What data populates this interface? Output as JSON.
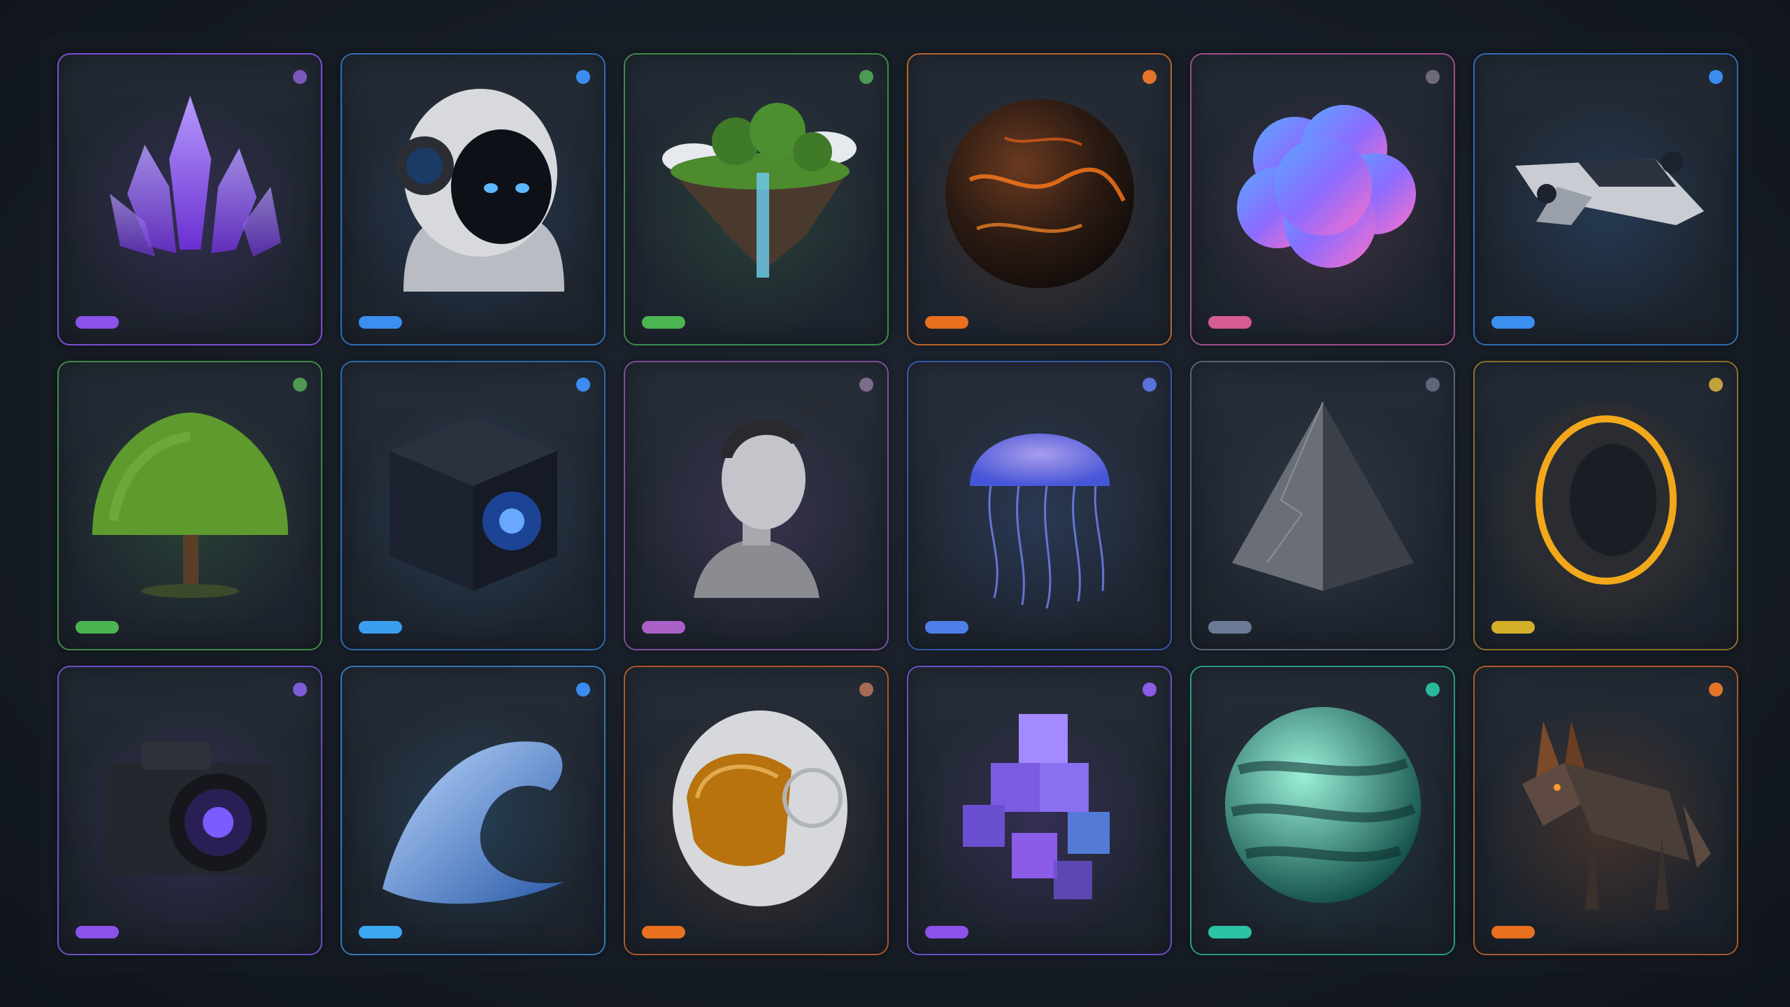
{
  "gallery": {
    "cards": [
      {
        "name": "crystal",
        "icon": "crystal-cluster-icon",
        "accent": "#7b4fd6",
        "dot": "#7a58b8",
        "pill": "#8a52e8"
      },
      {
        "name": "robot-head",
        "icon": "robot-astronaut-head-icon",
        "accent": "#2d6fb5",
        "dot": "#3a8cf0",
        "pill": "#3b8ff0"
      },
      {
        "name": "floating-island",
        "icon": "floating-island-icon",
        "accent": "#3d8a4a",
        "dot": "#4b9b53",
        "pill": "#4bb552"
      },
      {
        "name": "lava-planet",
        "icon": "lava-planet-icon",
        "accent": "#b8642a",
        "dot": "#e3742a",
        "pill": "#e8701f"
      },
      {
        "name": "pastel-cloud",
        "icon": "pastel-cloud-icon",
        "accent": "#a04e8c",
        "dot": "#6f6a7a",
        "pill": "#d45c93"
      },
      {
        "name": "spaceship",
        "icon": "spaceship-icon",
        "accent": "#2e6cb4",
        "dot": "#3a8cf0",
        "pill": "#3b8ff0"
      },
      {
        "name": "tree",
        "icon": "tree-icon",
        "accent": "#3f8a45",
        "dot": "#4e9a55",
        "pill": "#4bb552"
      },
      {
        "name": "tech-cube",
        "icon": "tech-cube-icon",
        "accent": "#2c6ab0",
        "dot": "#3a8cf0",
        "pill": "#3b9ef0"
      },
      {
        "name": "portrait-bust",
        "icon": "portrait-bust-icon",
        "accent": "#7d4f9e",
        "dot": "#7c6c8a",
        "pill": "#a961c8"
      },
      {
        "name": "jellyfish",
        "icon": "jellyfish-icon",
        "accent": "#3158a8",
        "dot": "#5a72d8",
        "pill": "#4e7fe8"
      },
      {
        "name": "stone-pyramid",
        "icon": "stone-pyramid-icon",
        "accent": "#5a6478",
        "dot": "#5e6678",
        "pill": "#6c7a96"
      },
      {
        "name": "golden-ring",
        "icon": "golden-ring-icon",
        "accent": "#8a6f2a",
        "dot": "#c2a23a",
        "pill": "#d4b02a"
      },
      {
        "name": "camera",
        "icon": "camera-icon",
        "accent": "#6d4fc4",
        "dot": "#7d5cd8",
        "pill": "#8a52e8"
      },
      {
        "name": "ocean-wave",
        "icon": "ocean-wave-icon",
        "accent": "#2f7ab8",
        "dot": "#3a8cf0",
        "pill": "#3ba7f0"
      },
      {
        "name": "space-helmet",
        "icon": "space-helmet-icon",
        "accent": "#a8592a",
        "dot": "#a86a54",
        "pill": "#e8701f"
      },
      {
        "name": "voxel-cubes",
        "icon": "voxel-cubes-icon",
        "accent": "#6a4fc8",
        "dot": "#8a5ce8",
        "pill": "#8a52e8"
      },
      {
        "name": "teal-sphere",
        "icon": "teal-sphere-icon",
        "accent": "#2a9a86",
        "dot": "#2ab89a",
        "pill": "#2ac4a4"
      },
      {
        "name": "low-poly-wolf",
        "icon": "low-poly-wolf-icon",
        "accent": "#a85a2a",
        "dot": "#e3742a",
        "pill": "#e8701f"
      }
    ]
  }
}
